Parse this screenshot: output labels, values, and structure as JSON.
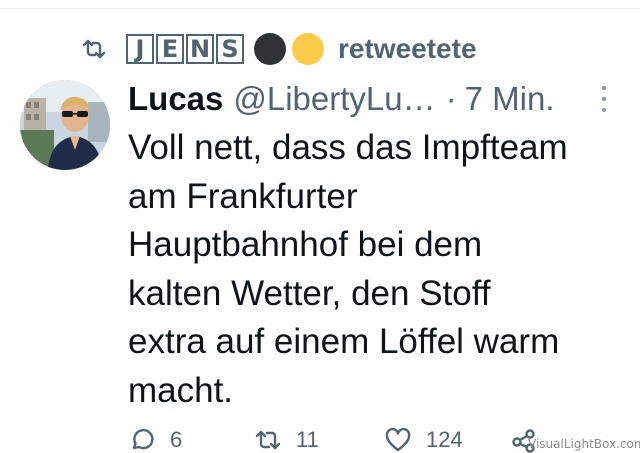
{
  "retweet": {
    "icon": "retweet-icon",
    "letters": [
      "J",
      "E",
      "N",
      "S"
    ],
    "dot_colors": [
      "#2f3336",
      "#fccb4a"
    ],
    "label": "retweetete"
  },
  "tweet": {
    "avatar_icon": "avatar-photo",
    "display_name": "Lucas",
    "handle": "@LibertyLu…",
    "separator": "·",
    "time": "7 Min.",
    "lines": [
      "Voll nett, dass das Impfteam",
      "am Frankfurter",
      "Hauptbahnhof bei dem",
      "kalten Wetter, den Stoff",
      "extra auf einem Löffel warm",
      "macht."
    ]
  },
  "actions": {
    "reply": {
      "icon": "reply-icon",
      "count": "6"
    },
    "retweet": {
      "icon": "retweet-icon",
      "count": "11"
    },
    "like": {
      "icon": "heart-icon",
      "count": "124"
    },
    "share": {
      "icon": "share-icon"
    }
  },
  "watermark": "VisualLightBox.com",
  "colors": {
    "text": "#0f1419",
    "secondary": "#536471"
  }
}
